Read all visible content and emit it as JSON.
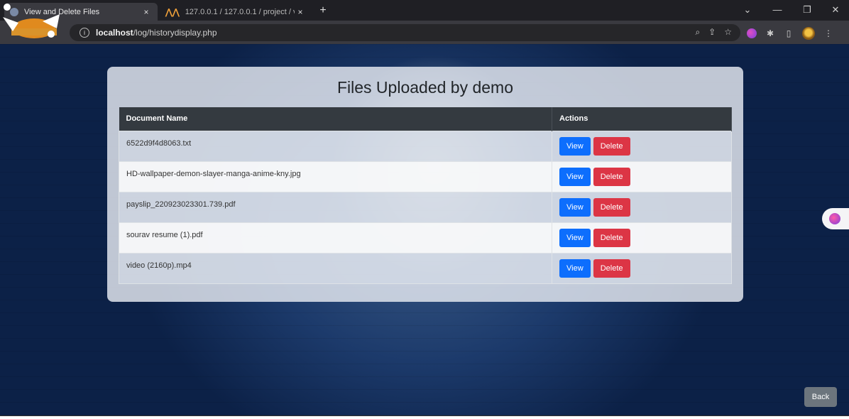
{
  "browser": {
    "tabs": [
      {
        "title": "View and Delete Files",
        "active": true
      },
      {
        "title": "127.0.0.1 / 127.0.0.1 / project / v",
        "active": false
      }
    ],
    "url_host": "localhost",
    "url_path": "/log/historydisplay.php",
    "new_tab": "+",
    "close_glyph": "×",
    "info_glyph": "i"
  },
  "page": {
    "heading": "Files Uploaded by demo",
    "table": {
      "headers": [
        "Document Name",
        "Actions"
      ],
      "rows": [
        {
          "name": "6522d9f4d8063.txt",
          "view": "View",
          "delete": "Delete"
        },
        {
          "name": "HD-wallpaper-demon-slayer-manga-anime-kny.jpg",
          "view": "View",
          "delete": "Delete"
        },
        {
          "name": "payslip_220923023301.739.pdf",
          "view": "View",
          "delete": "Delete"
        },
        {
          "name": "sourav resume (1).pdf",
          "view": "View",
          "delete": "Delete"
        },
        {
          "name": "video (2160p).mp4",
          "view": "View",
          "delete": "Delete"
        }
      ]
    },
    "back_label": "Back"
  },
  "colors": {
    "view": "#0d6efd",
    "delete": "#dc3545",
    "header": "#343a40",
    "back": "#6c757d"
  },
  "icons": [
    "globe-icon",
    "phpmyadmin-icon",
    "zoom-icon",
    "share-icon",
    "star-icon",
    "extension-brain-icon",
    "puzzle-icon",
    "sidepanel-icon",
    "profile-avatar-icon",
    "menu-dots-icon"
  ]
}
